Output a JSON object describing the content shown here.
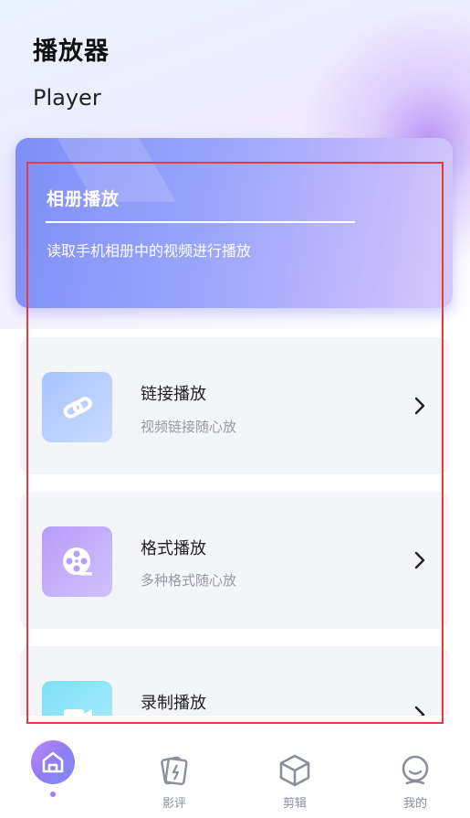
{
  "header": {
    "title": "播放器",
    "subtitle": "Player"
  },
  "album_card": {
    "title": "相册播放",
    "description": "读取手机相册中的视频进行播放"
  },
  "items": [
    {
      "title": "链接播放",
      "subtitle": "视频链接随心放",
      "icon": "link-icon",
      "color_from": "#a9c4ff",
      "color_to": "#c9dbff"
    },
    {
      "title": "格式播放",
      "subtitle": "多种格式随心放",
      "icon": "film-reel-icon",
      "color_from": "#b79cf9",
      "color_to": "#d1c2fb"
    },
    {
      "title": "录制播放",
      "subtitle": "",
      "icon": "video-camera-icon",
      "color_from": "#7fe0f5",
      "color_to": "#a9ecfa"
    }
  ],
  "tabbar": {
    "items": [
      {
        "label": "",
        "icon": "home-icon",
        "active": true
      },
      {
        "label": "影评",
        "icon": "review-cards-icon"
      },
      {
        "label": "剪辑",
        "icon": "cube-icon"
      },
      {
        "label": "我的",
        "icon": "profile-icon"
      }
    ]
  },
  "colors": {
    "accent": "#8f7cf3",
    "highlight_frame": "#e8393c",
    "muted_text": "#8a8f99"
  }
}
